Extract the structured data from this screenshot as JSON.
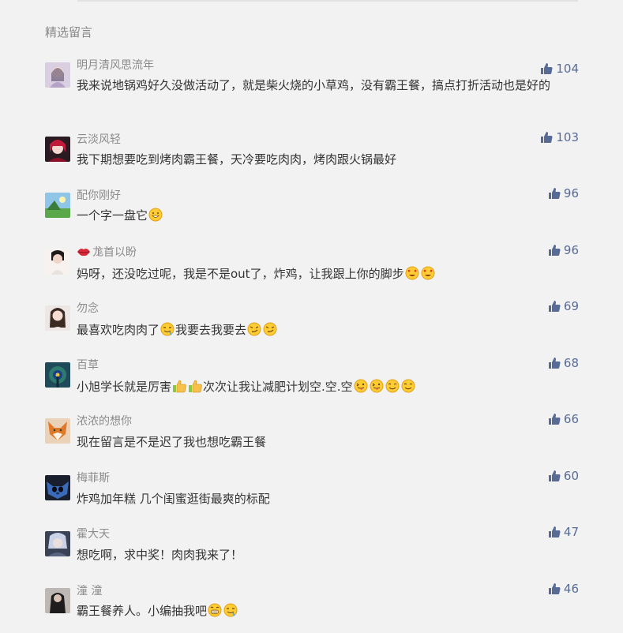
{
  "section": {
    "title": "精选留言"
  },
  "comments": [
    {
      "nickname": "明月清风思流年",
      "text": "我来说地锅鸡好久没做活动了，就是柴火烧的小草鸡，没有霸王餐，搞点打折活动也是好的",
      "likes": "104",
      "emojis": [],
      "avatar_icon": "avatar-girl-pink"
    },
    {
      "nickname": "云淡风轻",
      "text": "我下期想要吃到烤肉霸王餐，天冷要吃肉肉，烤肉跟火锅最好",
      "likes": "103",
      "emojis": [],
      "avatar_icon": "avatar-anime-red"
    },
    {
      "nickname": "配你刚好",
      "text": "一个字一盘它",
      "likes": "96",
      "emojis": [
        "grin"
      ],
      "avatar_icon": "avatar-landscape"
    },
    {
      "nickname": "尨首以盼",
      "nickname_prefix_icon": "lips-icon",
      "text": "妈呀，还没吃过呢，我是不是out了，炸鸡，让我跟上你的脚步",
      "likes": "96",
      "emojis": [
        "heart-eyes",
        "heart-eyes"
      ],
      "avatar_icon": "avatar-girl-white"
    },
    {
      "nickname": "勿念",
      "text_parts": [
        "最喜欢吃肉肉了",
        "我要去我要去"
      ],
      "likes": "69",
      "emojis_mid": [
        "drool"
      ],
      "emojis": [
        "smirk",
        "smirk"
      ],
      "avatar_icon": "avatar-girl-portrait"
    },
    {
      "nickname": "百草",
      "text_parts": [
        "小旭学长就是厉害",
        "次次让我让减肥计划空.空.空"
      ],
      "likes": "68",
      "emojis_mid": [
        "thumb",
        "thumb"
      ],
      "emojis": [
        "tongue",
        "tongue",
        "smile",
        "smile"
      ],
      "avatar_icon": "avatar-peacock"
    },
    {
      "nickname": "浓浓的想你",
      "text": "现在留言是不是迟了我也想吃霸王餐",
      "likes": "66",
      "emojis": [],
      "avatar_icon": "avatar-fox"
    },
    {
      "nickname": "梅菲斯",
      "text": "炸鸡加年糕 几个闺蜜逛街最爽的标配",
      "likes": "60",
      "emojis": [],
      "avatar_icon": "avatar-stitch"
    },
    {
      "nickname": "霍大天",
      "text": "想吃啊，求中奖！肉肉我来了！",
      "likes": "47",
      "emojis": [],
      "avatar_icon": "avatar-anime-grey"
    },
    {
      "nickname": "潼 潼",
      "text": "霸王餐养人。小编抽我吧",
      "likes": "46",
      "emojis": [
        "big-grin",
        "drool"
      ],
      "avatar_icon": "avatar-dark"
    }
  ],
  "colors": {
    "like": "#576b95",
    "nickname": "#8c8c8c",
    "text": "#333333"
  }
}
